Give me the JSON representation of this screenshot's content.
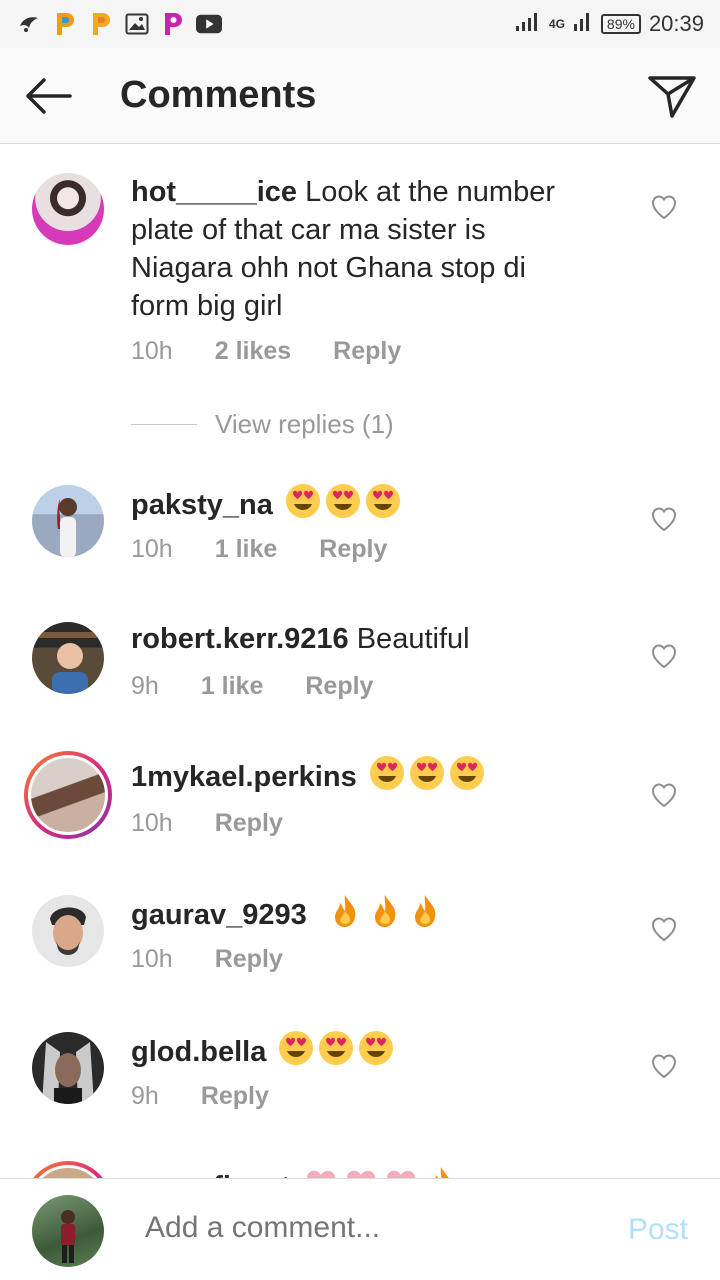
{
  "status_bar": {
    "network": "4G",
    "battery": "89%",
    "time": "20:39"
  },
  "header": {
    "title": "Comments",
    "back_icon": "back-arrow-icon",
    "send_icon": "paper-plane-icon"
  },
  "comments": [
    {
      "username": "hot_____ice",
      "text": "Look at the number plate of that car ma sister is Niagara ohh not Ghana stop di form big girl",
      "time": "10h",
      "likes": "2 likes",
      "reply_label": "Reply",
      "view_replies": "View replies (1)"
    },
    {
      "username": "paksty_na",
      "text": "",
      "emojis": "heart-eyes x3",
      "time": "10h",
      "likes": "1 like",
      "reply_label": "Reply"
    },
    {
      "username": "robert.kerr.9216",
      "text": "Beautiful",
      "time": "9h",
      "likes": "1 like",
      "reply_label": "Reply"
    },
    {
      "username": "1mykael.perkins",
      "text": "",
      "emojis": "heart-eyes x3",
      "time": "10h",
      "reply_label": "Reply"
    },
    {
      "username": "gaurav_9293",
      "text": "",
      "emojis": "fire x3",
      "time": "10h",
      "reply_label": "Reply"
    },
    {
      "username": "glod.bella",
      "text": "",
      "emojis": "heart-eyes x3",
      "time": "9h",
      "reply_label": "Reply"
    },
    {
      "username": "erewafinext",
      "text": "",
      "emojis": "hearts x3, fire",
      "partial": true
    }
  ],
  "composer": {
    "placeholder": "Add a comment...",
    "post_label": "Post"
  },
  "colors": {
    "post_disabled": "#b2dffc",
    "meta_gray": "#999999",
    "text": "#262626"
  }
}
